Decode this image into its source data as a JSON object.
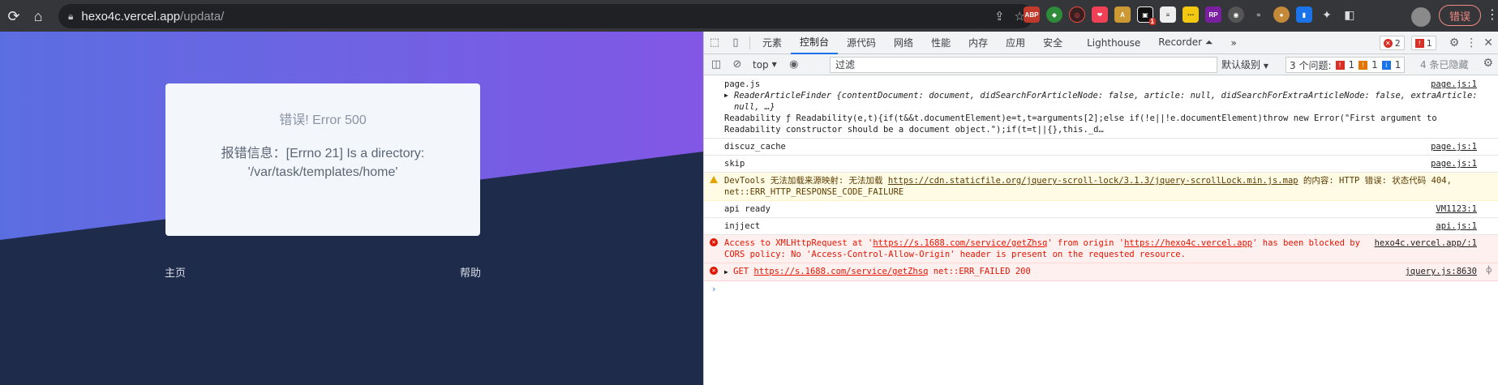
{
  "browser": {
    "url_host": "hexo4c.vercel.app",
    "url_path": "/updata/",
    "error_button_label": "错误",
    "extension_badge": "1"
  },
  "page": {
    "card_title": "错误! Error 500",
    "card_message": "报错信息：[Errno 21] Is a directory: '/var/task/templates/home'",
    "link_home": "主页",
    "link_help": "帮助",
    "colors": {
      "gradient_start": "#5b6ee1",
      "gradient_end": "#8257e5",
      "dark_bg": "#1e2b4a"
    }
  },
  "devtools": {
    "tabs": [
      "元素",
      "控制台",
      "源代码",
      "网络",
      "性能",
      "内存",
      "应用",
      "安全",
      "Lighthouse",
      "Recorder ⏶"
    ],
    "active_tab": "控制台",
    "error_count": "2",
    "issue_count": "1",
    "context": "top",
    "filter_placeholder": "过滤",
    "levels": "默认级别",
    "issues_label": "3 个问题:",
    "issues_err": "1",
    "issues_warn": "1",
    "issues_info": "1",
    "hidden": "4 条已隐藏",
    "messages": [
      {
        "type": "log",
        "line1": "page.js",
        "line2": "ReaderArticleFinder {contentDocument: document, didSearchForArticleNode: false, article: null, didSearchForExtraArticleNode: false, extraArticle: null, …}",
        "line3": "Readability ƒ Readability(e,t){if(t&&t.documentElement)e=t,t=arguments[2];else if(!e||!e.documentElement)throw new Error(\"First argument to Readability constructor should be a document object.\");if(t=t||{},this._d…",
        "source": "page.js:1"
      },
      {
        "type": "log",
        "text": "discuz_cache",
        "source": "page.js:1"
      },
      {
        "type": "log",
        "text": "skip",
        "source": "page.js:1"
      },
      {
        "type": "warn",
        "text_a": "DevTools 无法加载来源映射: 无法加载 ",
        "link": "https://cdn.staticfile.org/jquery-scroll-lock/3.1.3/jquery-scrollLock.min.js.map",
        "text_b": " 的内容: HTTP 错误: 状态代码 404, net::ERR_HTTP_RESPONSE_CODE_FAILURE"
      },
      {
        "type": "log",
        "text": "api ready",
        "source": "VM1123:1"
      },
      {
        "type": "log",
        "text": "injject",
        "source": "api.js:1"
      },
      {
        "type": "error",
        "text_a": "Access to XMLHttpRequest at '",
        "link1": "https://s.1688.com/service/getZhsq",
        "text_b": "' from origin '",
        "link2": "https://hexo4c.vercel.app",
        "text_c": "' has been blocked by CORS policy: No 'Access-Control-Allow-Origin' header is present on the requested resource.",
        "source": "hexo4c.vercel.app/:1"
      },
      {
        "type": "error",
        "text_a": "GET ",
        "link1": "https://s.1688.com/service/getZhsq",
        "text_b": " net::ERR_FAILED 200",
        "source": "jquery.js:8630"
      }
    ],
    "prompt": "›"
  }
}
